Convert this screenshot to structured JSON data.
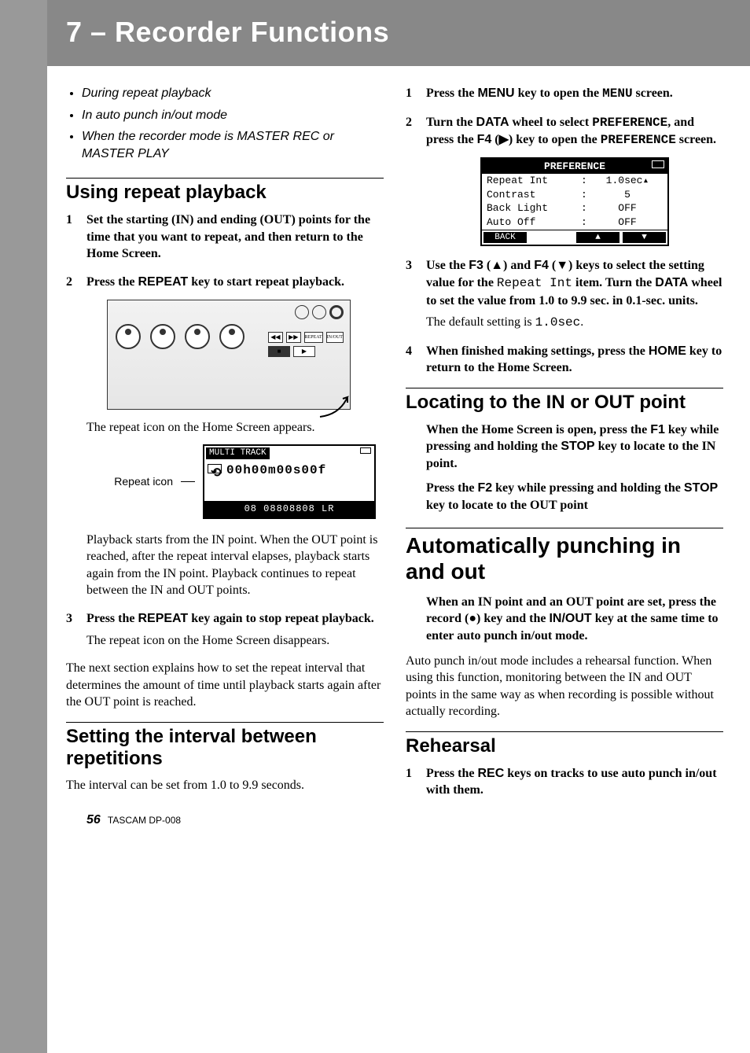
{
  "chapter": {
    "title": "7 – Recorder Functions"
  },
  "left": {
    "bullets": [
      "During repeat playback",
      "In auto punch in/out mode",
      "When the recorder mode is MASTER REC or MASTER PLAY"
    ],
    "h_repeat": "Using repeat playback",
    "steps_repeat": {
      "s1": "Set the starting (IN) and ending (OUT) points for the time that you want to repeat, and then return to the Home Screen.",
      "s2_a": "Press the ",
      "s2_key": "REPEAT",
      "s2_b": " key to start repeat playback."
    },
    "note_repeat_icon": "The repeat icon on the Home Screen appears.",
    "repeat_label": "Repeat icon",
    "lcd1": {
      "title": "MULTI TRACK",
      "time": "00h00m00s00f",
      "bottom": "08 08808808 LR"
    },
    "para_play": "Playback starts from the IN point. When the OUT point is reached, after the repeat interval elapses, playback starts again from the IN point. Playback continues to repeat between the IN and OUT points.",
    "s3_a": "Press the ",
    "s3_key": "REPEAT",
    "s3_b": " key again to stop repeat playback.",
    "s3_note": "The repeat icon on the Home Screen disappears.",
    "para_next": "The next section explains how to set the repeat interval that determines the amount of time until playback starts again after the OUT point is reached.",
    "h_interval": "Setting the interval between repetitions",
    "para_interval": "The interval can be set from 1.0 to 9.9 seconds."
  },
  "right": {
    "steps_pref": {
      "s1_a": "Press the ",
      "s1_key": "MENU",
      "s1_b": " key to open the ",
      "s1_scr": "MENU",
      "s1_c": " screen.",
      "s2_a": "Turn the ",
      "s2_key": "DATA",
      "s2_b": " wheel to select ",
      "s2_scr": "PREFERENCE",
      "s2_c": ", and press the ",
      "s2_key2": "F4",
      "s2_d": " (▶) key to open the ",
      "s2_scr2": "PREFERENCE",
      "s2_e": " screen."
    },
    "pref_lcd": {
      "hdr": "PREFERENCE",
      "rows": [
        {
          "k": "Repeat Int",
          "v": "1.0sec",
          "hl": true
        },
        {
          "k": "Contrast",
          "v": "5",
          "hl": false
        },
        {
          "k": "Back Light",
          "v": "OFF",
          "hl": false
        },
        {
          "k": "Auto Off",
          "v": "OFF",
          "hl": false
        }
      ],
      "back": "BACK",
      "up": "▲",
      "down": "▼"
    },
    "steps_pref2": {
      "s3_a": "Use the ",
      "s3_k1": "F3",
      "s3_g1": " (▲) and ",
      "s3_k2": "F4",
      "s3_g2": " (▼) keys to select the setting value for the ",
      "s3_item": "Repeat Int",
      "s3_b": " item. Turn the ",
      "s3_k3": "DATA",
      "s3_c": " wheel to set the value from 1.0 to 9.9 sec. in 0.1-sec. units.",
      "s3_note_a": "The default setting is ",
      "s3_note_val": "1.0sec",
      "s3_note_b": ".",
      "s4_a": "When finished making settings, press the ",
      "s4_key": "HOME",
      "s4_b": " key to return to the Home Screen."
    },
    "h_locate": "Locating to the IN or OUT point",
    "locate_p1_a": "When the Home Screen is open, press the ",
    "locate_p1_k1": "F1",
    "locate_p1_b": " key while pressing and holding the ",
    "locate_p1_k2": "STOP",
    "locate_p1_c": " key to locate to the IN point.",
    "locate_p2_a": "Press the ",
    "locate_p2_k1": "F2",
    "locate_p2_b": " key while pressing and holding the ",
    "locate_p2_k2": "STOP",
    "locate_p2_c": " key to locate to the OUT point",
    "h_auto": "Automatically punching in and out",
    "auto_lead_a": "When an IN point and an OUT point are set, press the record (●) key and the ",
    "auto_lead_k": "IN/OUT",
    "auto_lead_b": " key at the same time to enter auto punch in/out mode.",
    "auto_para": "Auto punch in/out mode includes a rehearsal function. When using this function, monitoring between the IN and OUT points in the same way as when recording is possible without actually recording.",
    "h_rehearsal": "Rehearsal",
    "reh_s1_a": "Press the ",
    "reh_s1_key": "REC",
    "reh_s1_b": " keys on tracks to use auto punch in/out with them."
  },
  "footer": {
    "pagenum": "56",
    "model": "TASCAM  DP-008"
  }
}
